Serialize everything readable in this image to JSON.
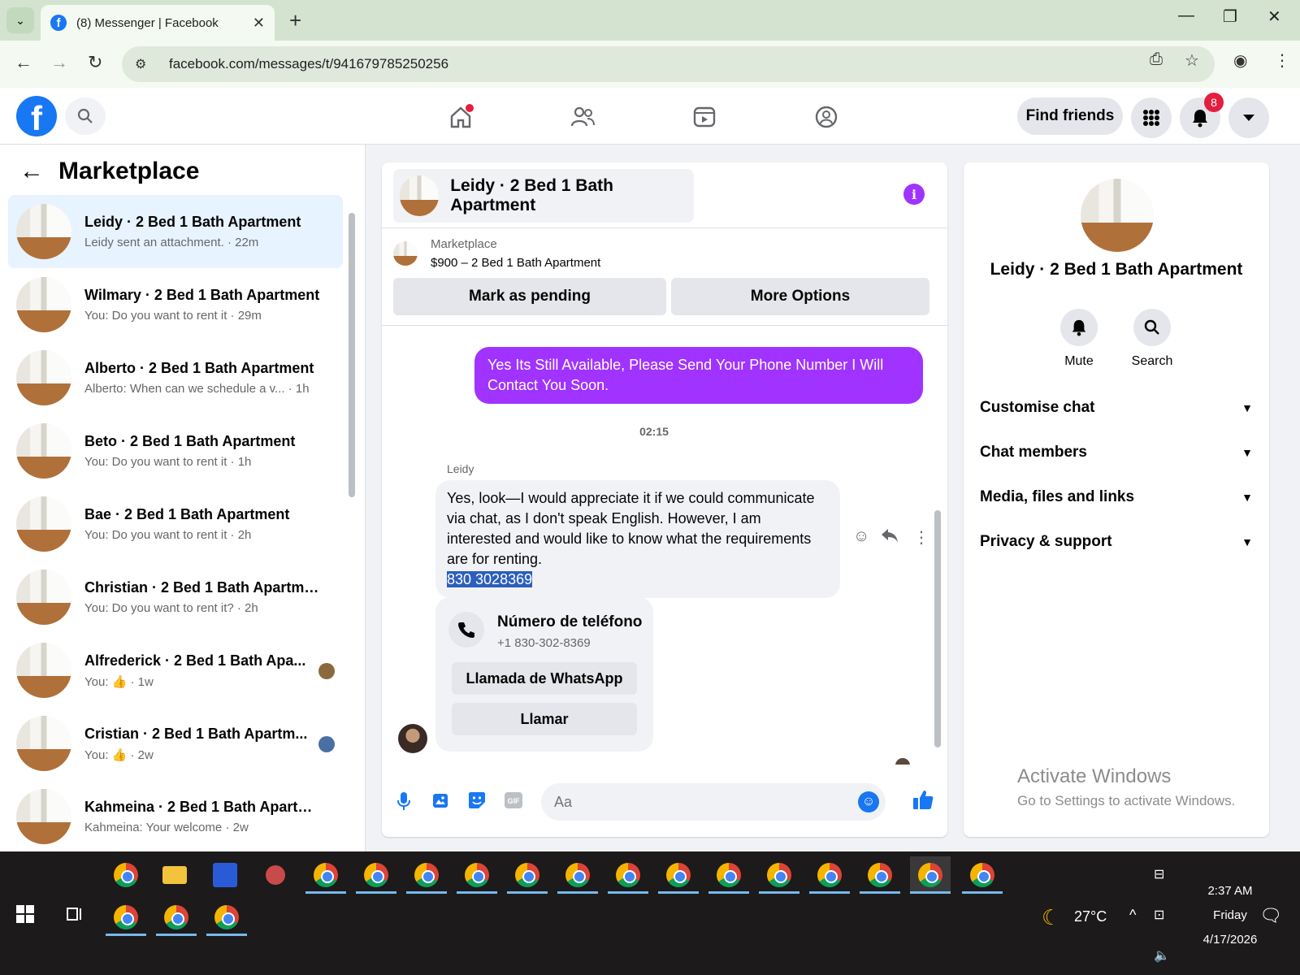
{
  "browser": {
    "tab_title": "(8) Messenger | Facebook",
    "url": "facebook.com/messages/t/941679785250256"
  },
  "fb_header": {
    "find_friends_label": "Find friends",
    "notifications_count": "8"
  },
  "marketplace": {
    "title": "Marketplace",
    "conversations": [
      {
        "name": "Leidy · 2 Bed 1 Bath Apartment",
        "snippet": "Leidy sent an attachment. · 22m"
      },
      {
        "name": "Wilmary · 2 Bed 1 Bath Apartment",
        "snippet": "You: Do you want to rent it · 29m"
      },
      {
        "name": "Alberto · 2 Bed 1 Bath Apartment",
        "snippet": "Alberto: When can we schedule a v... · 1h"
      },
      {
        "name": "Beto · 2 Bed 1 Bath Apartment",
        "snippet": "You: Do you want to rent it · 1h"
      },
      {
        "name": "Bae · 2 Bed 1 Bath Apartment",
        "snippet": "You: Do you want to rent it · 2h"
      },
      {
        "name": "Christian · 2 Bed 1 Bath Apartme...",
        "snippet": "You: Do you want to rent it? · 2h"
      },
      {
        "name": "Alfrederick · 2 Bed 1 Bath Apa...",
        "snippet": "You: 👍 · 1w"
      },
      {
        "name": "Cristian · 2 Bed 1 Bath Apartm...",
        "snippet": "You: 👍 · 2w"
      },
      {
        "name": "Kahmeina · 2 Bed 1 Bath Apartm...",
        "snippet": "Kahmeina: Your welcome · 2w"
      }
    ]
  },
  "chat": {
    "title": "Leidy · 2 Bed 1 Bath Apartment",
    "marketplace_label": "Marketplace",
    "listing": "$900 – 2 Bed 1 Bath Apartment",
    "mark_pending_label": "Mark as pending",
    "more_options_label": "More Options",
    "outgoing_message": "Yes Its Still Available, Please Send Your Phone Number I Will Contact You Soon.",
    "timestamp": "02:15",
    "sender_name": "Leidy",
    "incoming_message": "Yes, look—I would appreciate it if we could communicate via chat, as I don't speak English. However, I am interested and would like to know what the requirements are for renting.",
    "incoming_phone": "830 3028369",
    "phone_card": {
      "label": "Número de teléfono",
      "number": "+1 830-302-8369",
      "whatsapp_label": "Llamada de WhatsApp",
      "call_label": "Llamar"
    },
    "composer_placeholder": "Aa"
  },
  "info_panel": {
    "name": "Leidy · 2 Bed 1 Bath Apartment",
    "mute_label": "Mute",
    "search_label": "Search",
    "sections": [
      "Customise chat",
      "Chat members",
      "Media, files and links",
      "Privacy & support"
    ],
    "activate_title": "Activate Windows",
    "activate_sub": "Go to Settings to activate Windows."
  },
  "taskbar": {
    "weather": "27°C",
    "time": "2:37 AM",
    "day": "Friday",
    "date": "4/17/2026"
  },
  "colors": {
    "fb_blue": "#1877f2",
    "messenger_purple": "#a033ff",
    "notification_red": "#e41e3f"
  }
}
